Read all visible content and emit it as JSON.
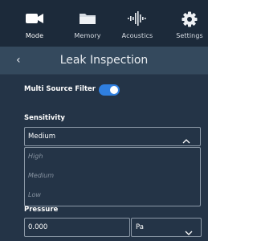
{
  "tabs": [
    {
      "label": "Mode",
      "icon": "video-camera-icon",
      "active": true
    },
    {
      "label": "Memory",
      "icon": "folder-icon",
      "active": false
    },
    {
      "label": "Acoustics",
      "icon": "sound-wave-icon",
      "active": false
    },
    {
      "label": "Settings",
      "icon": "gear-icon",
      "active": false
    }
  ],
  "header": {
    "back_glyph": "‹",
    "title": "Leak Inspection"
  },
  "multi_source_filter": {
    "label": "Multi Source Filter",
    "enabled": true
  },
  "sensitivity": {
    "label": "Sensitivity",
    "selected": "Medium",
    "options": [
      "High",
      "Medium",
      "Low"
    ]
  },
  "pressure": {
    "label": "Pressure",
    "value": "0.000",
    "unit": "Pa"
  },
  "colors": {
    "background": "#243447",
    "tabbar": "#1c2a3a",
    "header": "#34495d",
    "toggle_on": "#2f7fe0",
    "border": "#8c99a7",
    "option_text": "#8793a1"
  }
}
